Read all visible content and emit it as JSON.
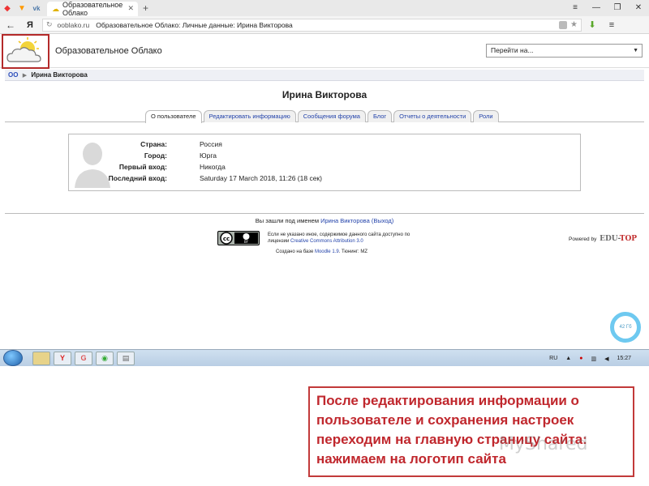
{
  "browser": {
    "tab_title": "Образовательное Облако",
    "url_domain": "ooblako.ru",
    "url_title": "Образовательное Облако: Личные данные: Ирина Викторова"
  },
  "header": {
    "site_name": "Образовательное Облако",
    "jump_placeholder": "Перейти на..."
  },
  "breadcrumb": {
    "home": "ОО",
    "current": "Ирина Викторова"
  },
  "profile": {
    "name": "Ирина Викторова",
    "tabs": [
      "О пользователе",
      "Редактировать информацию",
      "Сообщения форума",
      "Блог",
      "Отчеты о деятельности",
      "Роли"
    ],
    "fields": [
      {
        "label": "Страна:",
        "value": "Россия"
      },
      {
        "label": "Город:",
        "value": "Юрга"
      },
      {
        "label": "Первый вход:",
        "value": "Никогда"
      },
      {
        "label": "Последний вход:",
        "value": "Saturday 17 March 2018, 11:26  (18 сек)"
      }
    ]
  },
  "footer": {
    "logged_in_prefix": "Вы зашли под именем",
    "user_link": "Ирина Викторова",
    "logout_link": "(Выход)",
    "license_line1": "Если не указано иное, содержимое данного сайта доступно по",
    "license_line2_prefix": "лицензии",
    "license_link": "Creative Commons Attribution 3.0",
    "powered_by": "Powered by",
    "edu_logo_1": "EDU-",
    "edu_logo_2": "TOP",
    "created_prefix": "Создано на базе",
    "moodle_link": "Moodle 1.9",
    "created_suffix": ". Тюнинг: MZ",
    "cc_label": "BY"
  },
  "widget": {
    "ring_text": "42 Гб"
  },
  "taskbar": {
    "lang": "RU",
    "time": "15:27"
  },
  "annotation": {
    "text": "После редактирования информации о пользователе и сохранения настроек переходим на главную страницу сайта:  нажимаем на логотип сайта",
    "watermark": "MyShared"
  },
  "colors": {
    "accent_red": "#c0272d",
    "link_blue": "#2343aa"
  }
}
